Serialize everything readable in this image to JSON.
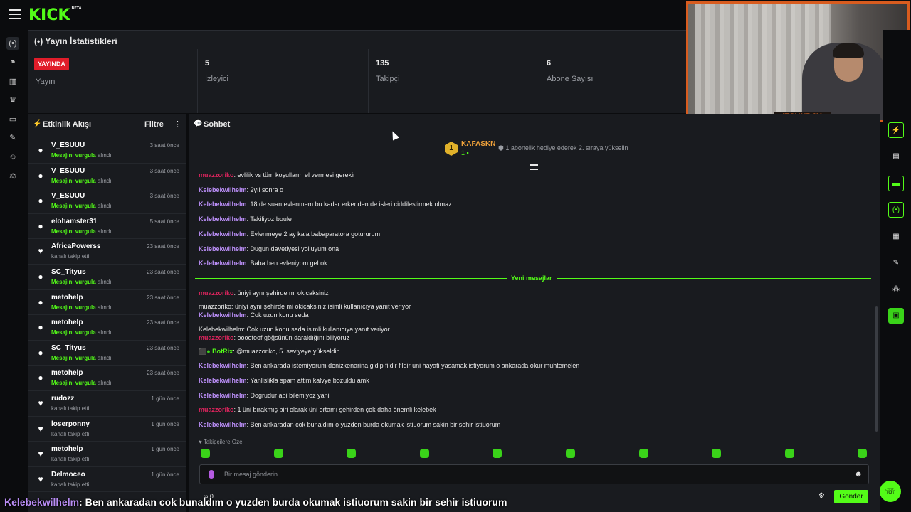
{
  "brand": {
    "logo": "KICK",
    "badge": "BETA",
    "accent": "#53fc18"
  },
  "left_rail": {
    "icons": [
      "live-icon",
      "link-icon",
      "chart-icon",
      "trophy-icon",
      "media-icon",
      "wrench-icon",
      "users-icon",
      "moderation-icon"
    ]
  },
  "stats": {
    "title": "Yayın İstatistikleri",
    "live_badge": "YAYINDA",
    "items": [
      {
        "value": "",
        "label": "Yayın"
      },
      {
        "value": "5",
        "label": "İzleyici"
      },
      {
        "value": "135",
        "label": "Takipçi"
      },
      {
        "value": "6",
        "label": "Abone Sayısı"
      }
    ]
  },
  "webcam": {
    "ticker": "ITSUNDAY"
  },
  "activity": {
    "title": "Etkinlik Akışı",
    "filter": "Filtre",
    "items": [
      {
        "user": "V_ESUUU",
        "highlight": "Mesajını vurgula",
        "suffix": " alındı",
        "time": "3 saat önce",
        "icon": "points-icon"
      },
      {
        "user": "V_ESUUU",
        "highlight": "Mesajını vurgula",
        "suffix": " alındı",
        "time": "3 saat önce",
        "icon": "points-icon"
      },
      {
        "user": "V_ESUUU",
        "highlight": "Mesajını vurgula",
        "suffix": " alındı",
        "time": "3 saat önce",
        "icon": "points-icon"
      },
      {
        "user": "elohamster31",
        "highlight": "Mesajını vurgula",
        "suffix": " alındı",
        "time": "5 saat önce",
        "icon": "points-icon"
      },
      {
        "user": "AfricaPowerss",
        "highlight": "",
        "suffix": "kanalı takip etti",
        "time": "23 saat önce",
        "icon": "heart-icon"
      },
      {
        "user": "SC_Tityus",
        "highlight": "Mesajını vurgula",
        "suffix": " alındı",
        "time": "23 saat önce",
        "icon": "points-icon"
      },
      {
        "user": "metohelp",
        "highlight": "Mesajını vurgula",
        "suffix": " alındı",
        "time": "23 saat önce",
        "icon": "points-icon"
      },
      {
        "user": "metohelp",
        "highlight": "Mesajını vurgula",
        "suffix": " alındı",
        "time": "23 saat önce",
        "icon": "points-icon"
      },
      {
        "user": "SC_Tityus",
        "highlight": "Mesajını vurgula",
        "suffix": " alındı",
        "time": "23 saat önce",
        "icon": "points-icon"
      },
      {
        "user": "metohelp",
        "highlight": "Mesajını vurgula",
        "suffix": " alındı",
        "time": "23 saat önce",
        "icon": "points-icon"
      },
      {
        "user": "rudozz",
        "highlight": "",
        "suffix": "kanalı takip etti",
        "time": "1 gün önce",
        "icon": "heart-icon"
      },
      {
        "user": "loserponny",
        "highlight": "",
        "suffix": "kanalı takip etti",
        "time": "1 gün önce",
        "icon": "heart-icon"
      },
      {
        "user": "metohelp",
        "highlight": "",
        "suffix": "kanalı takip etti",
        "time": "1 gün önce",
        "icon": "heart-icon"
      },
      {
        "user": "Delmoceo",
        "highlight": "",
        "suffix": "kanalı takip etti",
        "time": "1 gün önce",
        "icon": "heart-icon"
      }
    ]
  },
  "chat": {
    "title": "Sohbet",
    "pinned": {
      "rank": "1",
      "user": "KAFASKN",
      "count": "1",
      "message": "1 abonelik hediye ederek 2. sıraya yükselin"
    },
    "new_messages_label": "Yeni mesajlar",
    "follower_only": "Takipçilere Özel",
    "input_placeholder": "Bir mesaj gönderin",
    "send": "Gönder",
    "extra": "∞   0",
    "user_colors": {
      "muazzoriko": "#e0245e",
      "Kelebekwilhelm": "#b98df5",
      "BotRix": "#53fc18"
    },
    "messages_before": [
      {
        "user": "muazzoriko",
        "text": ": evlilik vs tüm koşulların el vermesi gerekir"
      },
      {
        "user": "Kelebekwilhelm",
        "text": ": 2yıl sonra o"
      },
      {
        "user": "Kelebekwilhelm",
        "text": ": 18 de suan evlenmem bu kadar erkenden de isleri ciddilestirmek olmaz"
      },
      {
        "user": "Kelebekwilhelm",
        "text": ": Takiliyoz boule"
      },
      {
        "user": "Kelebekwilhelm",
        "text": ": Evlenmeye 2 ay kala babaparatora gotururum"
      },
      {
        "user": "Kelebekwilhelm",
        "text": ": Dugun davetiyesi yolluyum ona"
      },
      {
        "user": "Kelebekwilhelm",
        "text": ": Baba ben evleniyom gel ok."
      }
    ],
    "messages_after": [
      {
        "user": "muazzoriko",
        "text": ": üniyi aynı şehirde mi okicaksiniz"
      },
      {
        "reply": "muazzoriko: üniyi aynı şehirde mi okicaksiniz isimli kullanıcıya yanıt veriyor",
        "user": "Kelebekwilhelm",
        "text": ": Cok uzun konu seda"
      },
      {
        "reply": "Kelebekwilhelm: Cok uzun konu seda isimli kullanıcıya yanıt veriyor",
        "user": "muazzoriko",
        "text": ": oooofoof göğsünün daraldığını biliyoruz"
      },
      {
        "user": "BotRix",
        "text": ": @muazzoriko, 5. seviyeye yükseldin."
      },
      {
        "user": "Kelebekwilhelm",
        "text": ": Ben ankarada istemiyorum denizkenarina gidip fildir fildir uni hayati yasamak istiyorum o ankarada okur muhtemelen"
      },
      {
        "user": "Kelebekwilhelm",
        "text": ": Yanlislikla spam attim kalvye bozuldu amk"
      },
      {
        "user": "Kelebekwilhelm",
        "text": ": Dogrudur abi bilemiyoz yani"
      },
      {
        "user": "muazzoriko",
        "text": ": 1 üni bırakmış biri olarak üni ortamı şehirden çok daha önemli kelebek"
      },
      {
        "user": "Kelebekwilhelm",
        "text": ": Ben ankaradan cok bunaldım o yuzden burda okumak istiuorum sakin bir sehir istiuorum"
      }
    ]
  },
  "right_rail": {
    "icons": [
      "bolt-icon",
      "document-icon",
      "chat-icon",
      "broadcast-icon",
      "layout-icon",
      "wrench-icon",
      "share-icon",
      "clapper-icon"
    ]
  },
  "overlay": {
    "user": "Kelebekwilhelm",
    "text": ": Ben ankaradan cok bunaldım o yuzden burda okumak istiuorum sakin bir sehir istiuorum"
  }
}
